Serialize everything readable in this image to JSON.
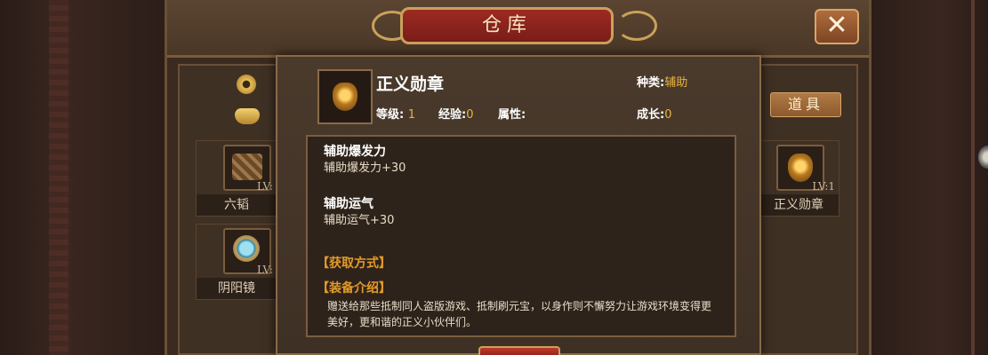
{
  "window": {
    "title": "仓库",
    "close_label": "✕"
  },
  "tabs": {
    "items_label": "道具"
  },
  "inventory": [
    {
      "name": "六韬",
      "level": "LV:"
    },
    {
      "name": "阴阳镜",
      "level": "LV:"
    },
    {
      "name": "正义勋章",
      "level": "LV:1"
    }
  ],
  "tooltip": {
    "name": "正义勋章",
    "type_label": "种类:",
    "type_value": "辅助",
    "level_label": "等级:",
    "level_value": "1",
    "exp_label": "经验:",
    "exp_value": "0",
    "attr_label": "属性:",
    "growth_label": "成长:",
    "growth_value": "0",
    "attributes": [
      {
        "title": "辅助爆发力",
        "value": "辅助爆发力+30"
      },
      {
        "title": "辅助运气",
        "value": "辅助运气+30"
      }
    ],
    "obtain_header": "【获取方式】",
    "intro_header": "【装备介绍】",
    "description": "赠送给那些抵制同人盗版游戏、抵制刷元宝，以身作则不懈努力让游戏环境变得更美好，更和谐的正义小伙伴们。"
  },
  "colors": {
    "accent": "#e39a2a",
    "value": "#e8b440",
    "title_plaque": "#9c2a22"
  },
  "icons": [
    "coin-icon",
    "ingot-icon",
    "close-icon",
    "scroll-icon",
    "mirror-icon",
    "badge-icon"
  ]
}
